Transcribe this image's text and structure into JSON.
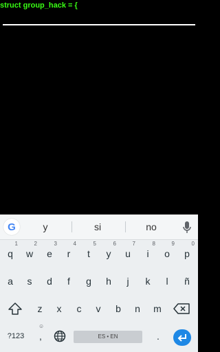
{
  "editor": {
    "code_line": "struct group_hack = {"
  },
  "keyboard": {
    "suggestions": [
      "y",
      "si",
      "no"
    ],
    "row1": [
      {
        "k": "q",
        "h": "1"
      },
      {
        "k": "w",
        "h": "2"
      },
      {
        "k": "e",
        "h": "3"
      },
      {
        "k": "r",
        "h": "4"
      },
      {
        "k": "t",
        "h": "5"
      },
      {
        "k": "y",
        "h": "6"
      },
      {
        "k": "u",
        "h": "7"
      },
      {
        "k": "i",
        "h": "8"
      },
      {
        "k": "o",
        "h": "9"
      },
      {
        "k": "p",
        "h": "0"
      }
    ],
    "row2": [
      "a",
      "s",
      "d",
      "f",
      "g",
      "h",
      "j",
      "k",
      "l",
      "ñ"
    ],
    "row3": [
      "z",
      "x",
      "c",
      "v",
      "b",
      "n",
      "m"
    ],
    "bottom": {
      "symbols_label": "?123",
      "comma": ",",
      "space_label": "ES • EN",
      "period": "."
    },
    "accent_color": "#1e88e5"
  }
}
